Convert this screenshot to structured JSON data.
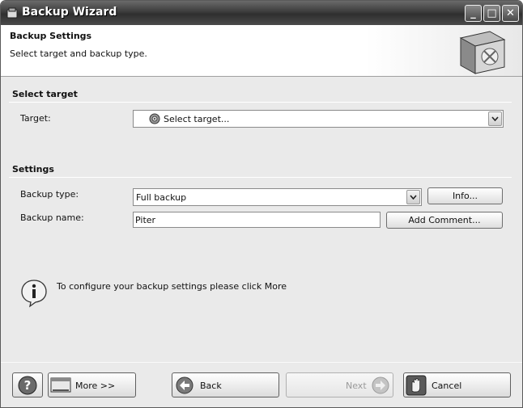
{
  "window": {
    "title": "Backup Wizard",
    "controls": {
      "minimize": "_",
      "maximize": "□",
      "close": "✕"
    }
  },
  "header": {
    "title": "Backup Settings",
    "subtitle": "Select target and backup type.",
    "art_icon": "backup-box-icon"
  },
  "target_section": {
    "title": "Select target",
    "target_label": "Target:",
    "target_value": "Select target...",
    "target_icon": "disc-icon"
  },
  "settings_section": {
    "title": "Settings",
    "backup_type_label": "Backup type:",
    "backup_type_value": "Full backup",
    "info_button": "Info...",
    "backup_name_label": "Backup name:",
    "backup_name_value": "Piter",
    "add_comment_button": "Add Comment..."
  },
  "info": {
    "icon": "info-icon",
    "text": "To configure your backup settings please click More"
  },
  "footer": {
    "help_icon": "help-icon",
    "more_label": "More >>",
    "back_label": "Back",
    "next_label": "Next",
    "next_enabled": false,
    "cancel_label": "Cancel"
  }
}
